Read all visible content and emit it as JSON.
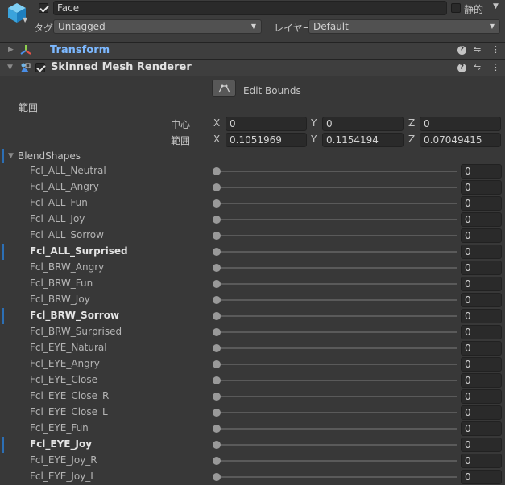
{
  "header": {
    "object_name": "Face",
    "static_label": "静的",
    "tag_label": "タグ",
    "tag_value": "Untagged",
    "layer_label": "レイヤー",
    "layer_value": "Default"
  },
  "transform": {
    "title": "Transform"
  },
  "renderer": {
    "title": "Skinned Mesh Renderer",
    "edit_bounds_label": "Edit Bounds",
    "bounds_label": "範囲",
    "center_label": "中心",
    "extent_label": "範囲",
    "center": {
      "x_label": "X",
      "x": "0",
      "y_label": "Y",
      "y": "0",
      "z_label": "Z",
      "z": "0"
    },
    "extent": {
      "x_label": "X",
      "x": "0.1051969",
      "y_label": "Y",
      "y": "0.1154194",
      "z_label": "Z",
      "z": "0.07049415"
    }
  },
  "blendshapes": {
    "label": "BlendShapes",
    "items": [
      {
        "name": "Fcl_ALL_Neutral",
        "value": "0",
        "level": 0,
        "bold": false
      },
      {
        "name": "Fcl_ALL_Angry",
        "value": "0",
        "level": 0,
        "bold": false
      },
      {
        "name": "Fcl_ALL_Fun",
        "value": "0",
        "level": 0,
        "bold": false
      },
      {
        "name": "Fcl_ALL_Joy",
        "value": "0",
        "level": 0,
        "bold": false
      },
      {
        "name": "Fcl_ALL_Sorrow",
        "value": "0",
        "level": 0,
        "bold": false
      },
      {
        "name": "Fcl_ALL_Surprised",
        "value": "0",
        "level": 0,
        "bold": true
      },
      {
        "name": "Fcl_BRW_Angry",
        "value": "0",
        "level": 0,
        "bold": false
      },
      {
        "name": "Fcl_BRW_Fun",
        "value": "0",
        "level": 0,
        "bold": false
      },
      {
        "name": "Fcl_BRW_Joy",
        "value": "0",
        "level": 0,
        "bold": false
      },
      {
        "name": "Fcl_BRW_Sorrow",
        "value": "0",
        "level": 0,
        "bold": true
      },
      {
        "name": "Fcl_BRW_Surprised",
        "value": "0",
        "level": 0,
        "bold": false
      },
      {
        "name": "Fcl_EYE_Natural",
        "value": "0",
        "level": 0,
        "bold": false
      },
      {
        "name": "Fcl_EYE_Angry",
        "value": "0",
        "level": 0,
        "bold": false
      },
      {
        "name": "Fcl_EYE_Close",
        "value": "0",
        "level": 0,
        "bold": false
      },
      {
        "name": "Fcl_EYE_Close_R",
        "value": "0",
        "level": 0,
        "bold": false
      },
      {
        "name": "Fcl_EYE_Close_L",
        "value": "0",
        "level": 0,
        "bold": false
      },
      {
        "name": "Fcl_EYE_Fun",
        "value": "0",
        "level": 0,
        "bold": false
      },
      {
        "name": "Fcl_EYE_Joy",
        "value": "0",
        "level": 0,
        "bold": true
      },
      {
        "name": "Fcl_EYE_Joy_R",
        "value": "0",
        "level": 0,
        "bold": false
      },
      {
        "name": "Fcl_EYE_Joy_L",
        "value": "0",
        "level": 0,
        "bold": false
      }
    ]
  },
  "colors": {
    "accent": "#2c6fb5",
    "transform_title": "#7cb8ff"
  },
  "icons": {
    "object": "cube-icon",
    "transform": "axis-gizmo-icon",
    "renderer": "skinned-mesh-icon",
    "edit_bounds": "bounds-edit-icon",
    "help": "help-icon",
    "presets": "sliders-icon",
    "menu": "kebab-menu-icon"
  }
}
